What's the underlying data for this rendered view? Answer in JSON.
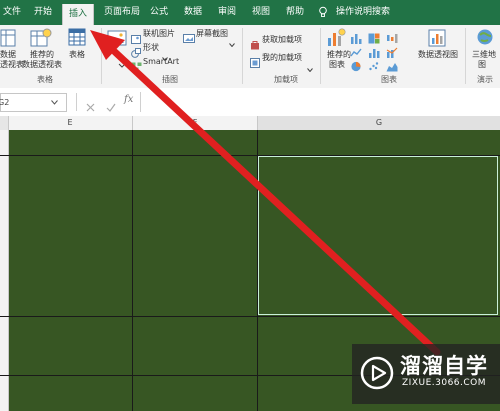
{
  "tabs": [
    "文件",
    "开始",
    "插入",
    "页面布局",
    "公式",
    "数据",
    "审阅",
    "视图",
    "帮助",
    "操作说明搜索"
  ],
  "active_tab": "插入",
  "ribbon": {
    "tables_group": {
      "label": "表格",
      "pivot_btn": [
        "数据",
        "透视表"
      ],
      "rec_pivot_btn": [
        "推荐的",
        "数据透视表"
      ],
      "table_btn": "表格"
    },
    "illustrations_group": {
      "label": "插图",
      "online_pictures": "联机图片",
      "shapes": "形状",
      "smartart": "SmartArt",
      "screenshot": "屏幕截图"
    },
    "addins_group": {
      "label": "加载项",
      "get_addins": "获取加载项",
      "my_addins": "我的加载项"
    },
    "charts_group": {
      "label": "图表",
      "rec_charts": [
        "推荐的",
        "图表"
      ],
      "pivot_chart": "数据透视图"
    },
    "tours_group": {
      "label": "演示",
      "map3d": [
        "三维地",
        "图"
      ]
    }
  },
  "namebox": "G2",
  "columns": [
    "E",
    "F",
    "G"
  ],
  "watermark": {
    "title": "溜溜自学",
    "url": "ZIXUE.3066.COM"
  },
  "colors": {
    "excel_green": "#217346",
    "cell_fill": "#375623",
    "arrow": "#e02020",
    "selection": "#c9f0d8"
  }
}
